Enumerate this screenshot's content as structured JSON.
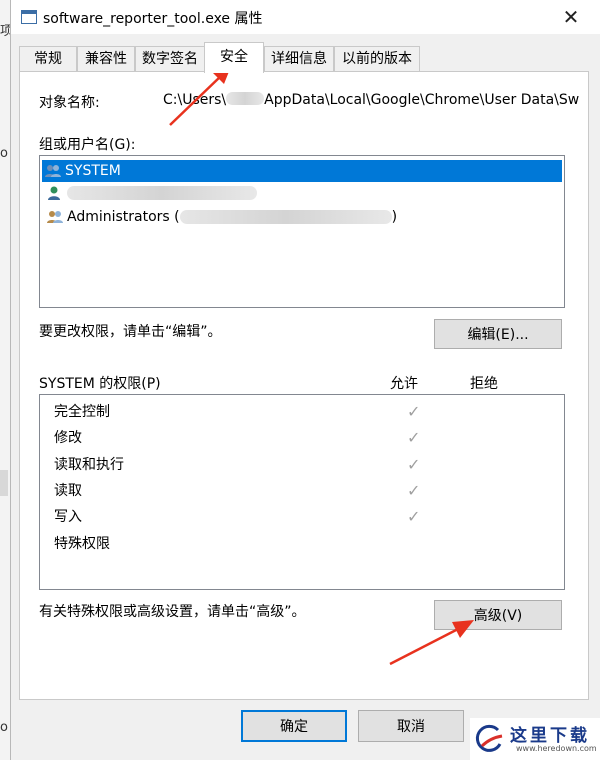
{
  "window": {
    "title": "software_reporter_tool.exe 属性",
    "close_glyph": "✕"
  },
  "tabs": [
    {
      "label": "常规"
    },
    {
      "label": "兼容性"
    },
    {
      "label": "数字签名"
    },
    {
      "label": "安全",
      "active": true
    },
    {
      "label": "详细信息"
    },
    {
      "label": "以前的版本"
    }
  ],
  "security": {
    "object_label": "对象名称:",
    "object_path_prefix": "C:\\Users\\",
    "object_path_suffix": "AppData\\Local\\Google\\Chrome\\User Data\\Sw",
    "groups_label": "组或用户名(G):",
    "users": [
      {
        "name": "SYSTEM",
        "icon": "group-users-icon",
        "selected": true
      },
      {
        "name": "",
        "icon": "user-icon",
        "selected": false
      },
      {
        "name": "Administrators (",
        "suffix": ")",
        "icon": "group-users-icon",
        "selected": false
      }
    ],
    "change_hint": "要更改权限，请单击“编辑”。",
    "edit_button": "编辑(E)...",
    "permissions_label": "SYSTEM 的权限(P)",
    "allow_header": "允许",
    "deny_header": "拒绝",
    "permissions": [
      {
        "name": "完全控制",
        "allow": true
      },
      {
        "name": "修改",
        "allow": true
      },
      {
        "name": "读取和执行",
        "allow": true
      },
      {
        "name": "读取",
        "allow": true
      },
      {
        "name": "写入",
        "allow": true
      },
      {
        "name": "特殊权限",
        "allow": false
      }
    ],
    "check_glyph": "✓",
    "advanced_hint": "有关特殊权限或高级设置，请单击“高级”。",
    "advanced_button": "高级(V)"
  },
  "footer": {
    "ok_button": "确定",
    "cancel_button": "取消"
  },
  "background_fragments": [
    "项",
    "o",
    "o"
  ],
  "watermark": {
    "title": "这里下载",
    "url": "www.heredown.com"
  },
  "colors": {
    "selection": "#0078d7",
    "arrow": "#e8321e",
    "check": "#a0a0a0"
  }
}
